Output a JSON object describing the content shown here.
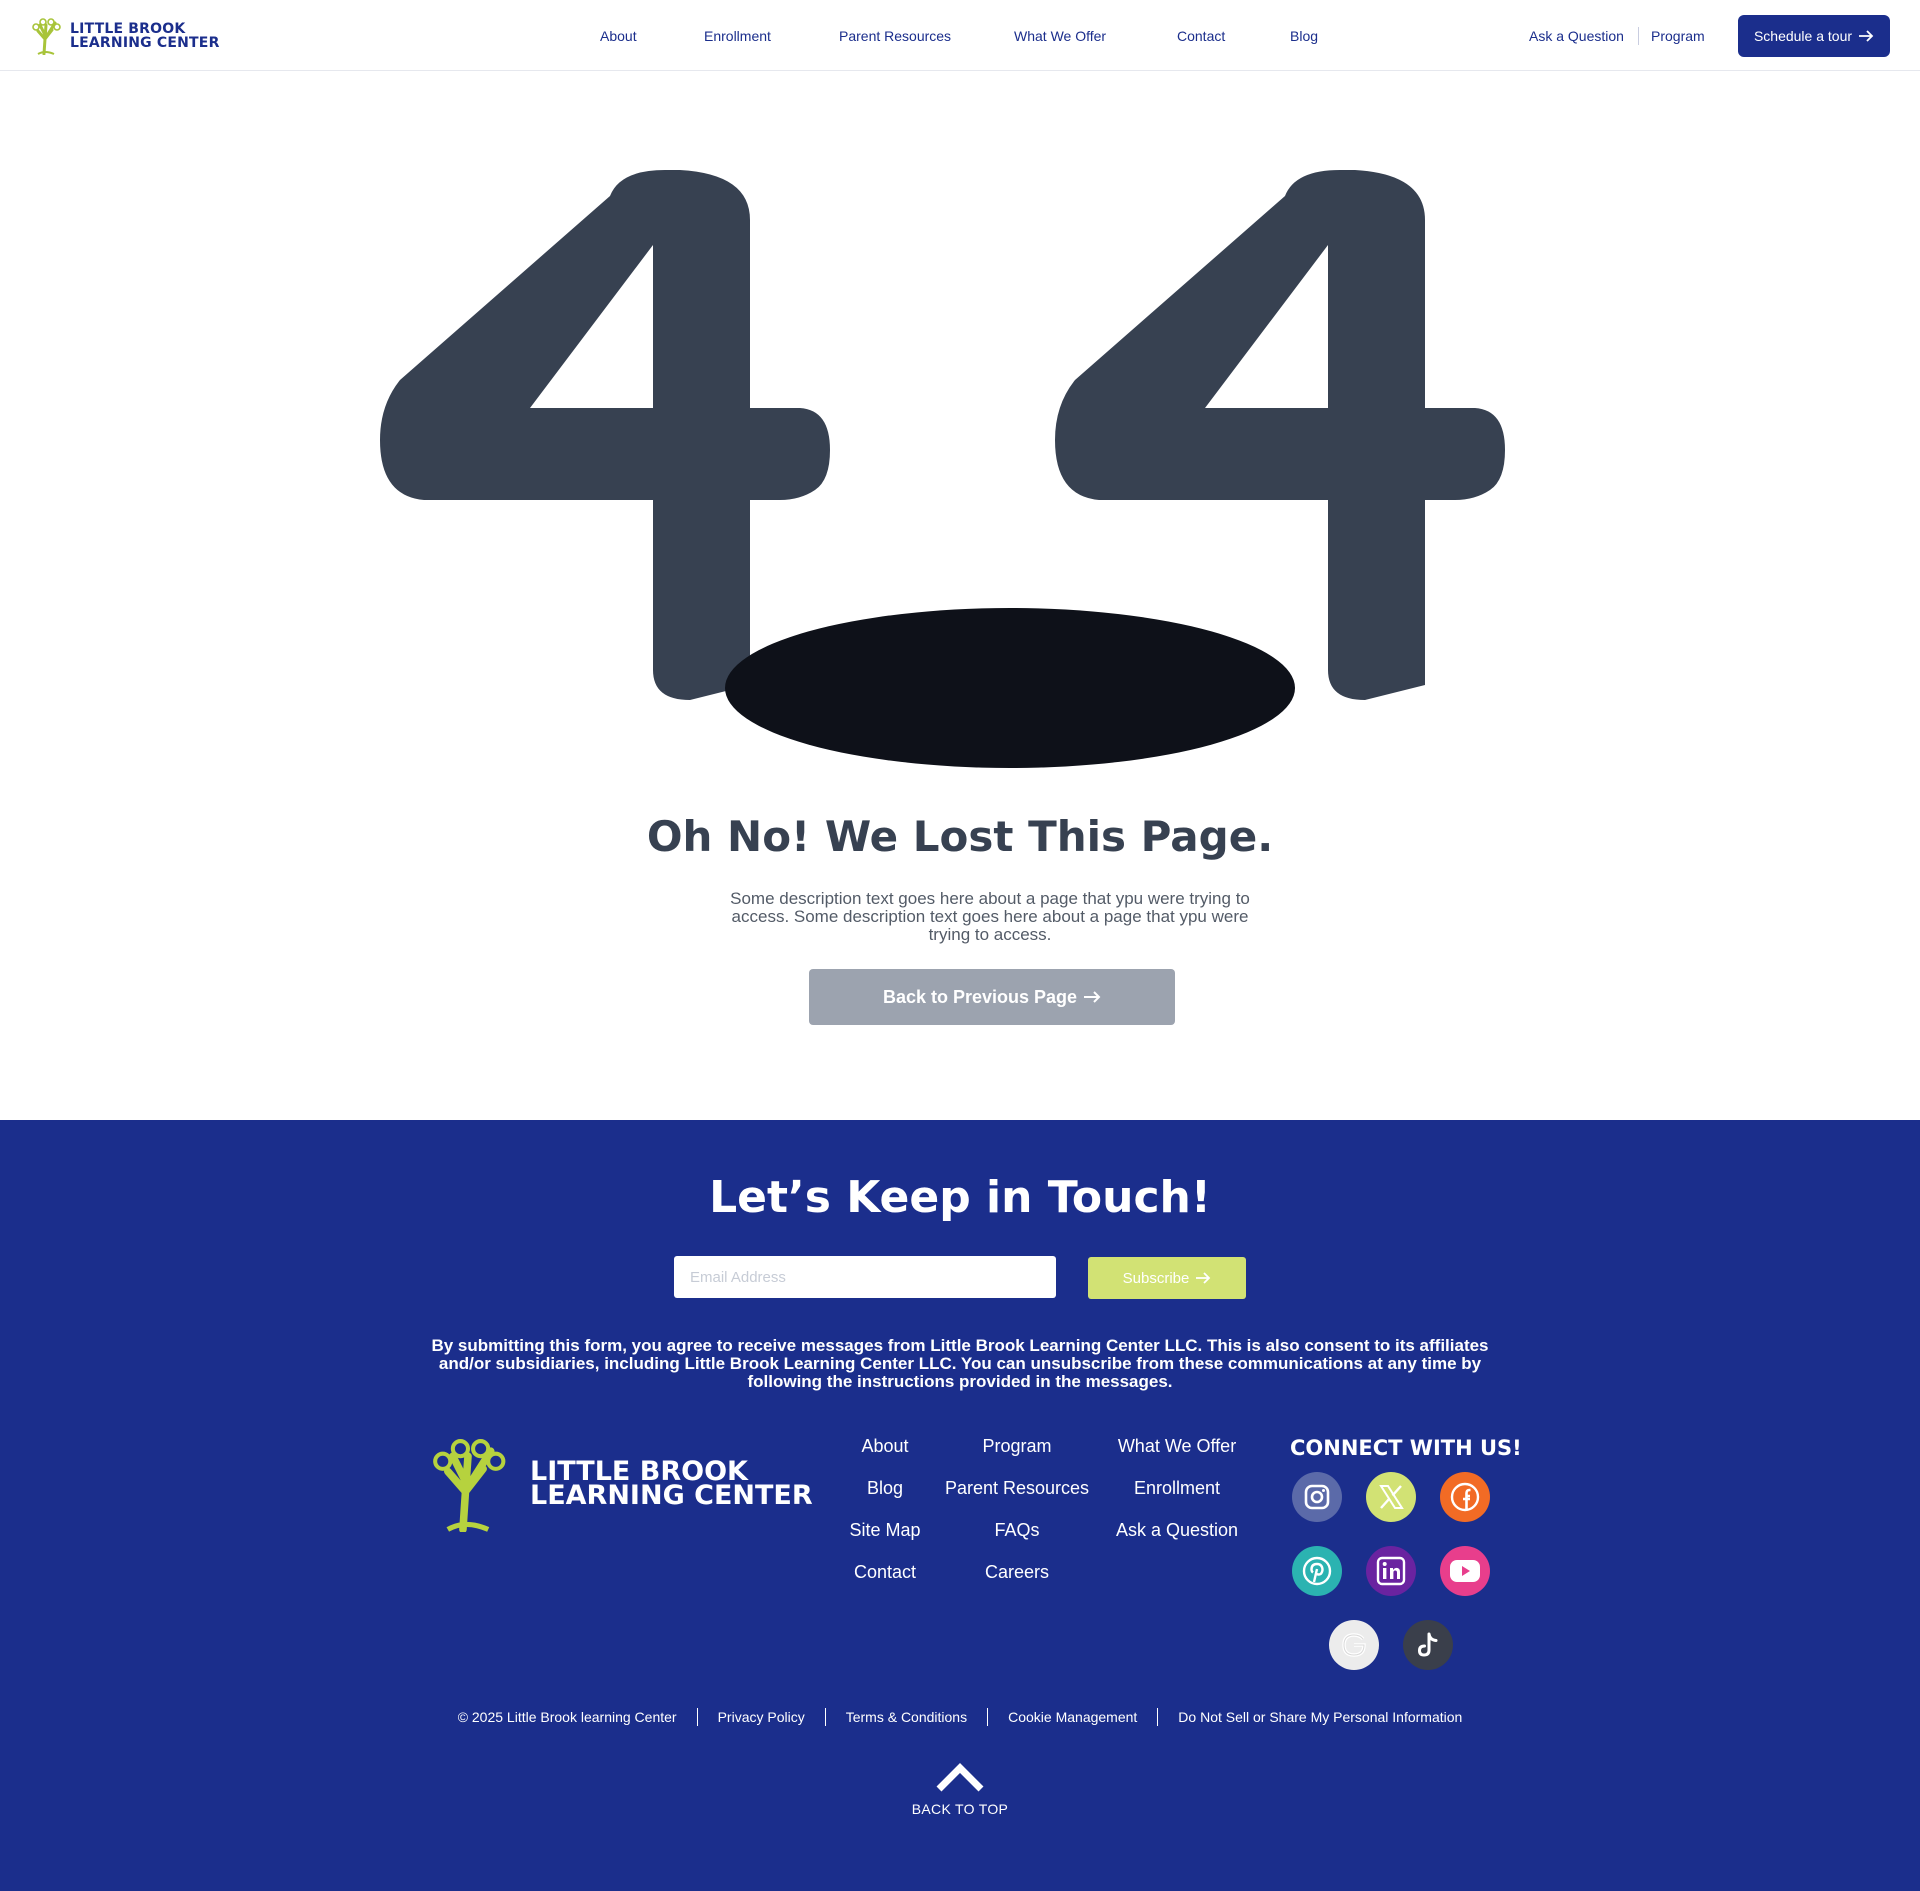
{
  "header": {
    "logo_line1": "LITTLE BROOK",
    "logo_line2": "LEARNING CENTER",
    "nav": [
      "About",
      "Enrollment",
      "Parent Resources",
      "What We Offer",
      "Contact",
      "Blog"
    ],
    "ask_question": "Ask a Question",
    "program": "Program",
    "cta_label": "Schedule a tour",
    "cta_icon": "arrow-right-icon"
  },
  "error": {
    "digit_left": "4",
    "digit_right": "4",
    "hole_icon": "hole-shape",
    "title": "Oh No! We Lost This Page.",
    "description": "Some description text goes here about a page that ypu were trying to access. Some description text goes here about a page that ypu were trying to access.",
    "back_label": "Back to Previous Page",
    "back_icon": "arrow-right-icon"
  },
  "footer": {
    "heading": "Let’s Keep in Touch!",
    "email_placeholder": "Email Address",
    "subscribe_label": "Subscribe",
    "consent": "By submitting this form, you agree to receive messages from Little Brook Learning Center LLC. This is also consent to its affiliates and/or subsidiaries, including Little Brook Learning Center LLC. You can unsubscribe from these communications at any time by following the instructions provided in the messages.",
    "logo_line1": "LITTLE BROOK",
    "logo_line2": "LEARNING CENTER",
    "links": {
      "col1": [
        "About",
        "Blog",
        "Site Map",
        "Contact"
      ],
      "col2": [
        "Program",
        "Parent Resources",
        "FAQs",
        "Careers"
      ],
      "col3": [
        "What We Offer",
        "Enrollment",
        "Ask a Question"
      ]
    },
    "connect_heading": "CONNECT WITH US!",
    "social": [
      {
        "name": "instagram-icon",
        "color": "#5b6aa9"
      },
      {
        "name": "x-icon",
        "color": "#d2e274"
      },
      {
        "name": "facebook-icon",
        "color": "#f26b25"
      },
      {
        "name": "pinterest-icon",
        "color": "#2bb3b1"
      },
      {
        "name": "linkedin-icon",
        "color": "#6a23a0"
      },
      {
        "name": "youtube-icon",
        "color": "#e83e8c"
      },
      {
        "name": "google-icon",
        "color": "#ececec"
      },
      {
        "name": "tiktok-icon",
        "color": "#3a3f4b"
      }
    ],
    "legal": {
      "copyright": "© 2025 Little Brook learning Center",
      "privacy": "Privacy Policy",
      "terms": "Terms & Conditions",
      "cookie": "Cookie Management",
      "do_not_sell": "Do Not Sell or Share My Personal Information"
    },
    "back_to_top": "BACK TO TOP"
  },
  "colors": {
    "brand_blue": "#1b2e8c",
    "lime": "#d2e274",
    "digit_gray": "#374151",
    "hole": "#0e1119",
    "button_gray": "#9ca3af"
  }
}
